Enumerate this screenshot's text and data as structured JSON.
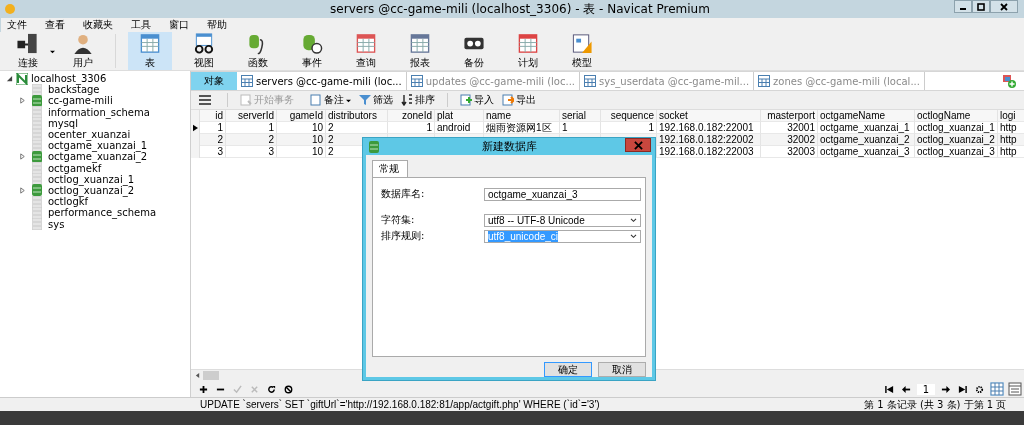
{
  "window": {
    "title": "servers @cc-game-mili (localhost_3306) - 表 - Navicat Premium"
  },
  "menu": [
    "文件",
    "查看",
    "收藏夹",
    "工具",
    "窗口",
    "帮助"
  ],
  "toolbar": [
    {
      "label": "连接",
      "selected": false
    },
    {
      "label": "用户",
      "selected": false
    },
    {
      "label": "表",
      "selected": true
    },
    {
      "label": "视图",
      "selected": false
    },
    {
      "label": "函数",
      "selected": false
    },
    {
      "label": "事件",
      "selected": false
    },
    {
      "label": "查询",
      "selected": false
    },
    {
      "label": "报表",
      "selected": false
    },
    {
      "label": "备份",
      "selected": false
    },
    {
      "label": "计划",
      "selected": false
    },
    {
      "label": "模型",
      "selected": false
    }
  ],
  "tree": {
    "label": "localhost_3306",
    "expanded": true,
    "children": [
      {
        "label": "backstage",
        "opened": false
      },
      {
        "label": "cc-game-mili",
        "opened": true
      },
      {
        "label": "information_schema",
        "opened": false
      },
      {
        "label": "mysql",
        "opened": false
      },
      {
        "label": "ocenter_xuanzai",
        "opened": false
      },
      {
        "label": "octgame_xuanzai_1",
        "opened": false
      },
      {
        "label": "octgame_xuanzai_2",
        "opened": true
      },
      {
        "label": "octgamekf",
        "opened": false
      },
      {
        "label": "octlog_xuanzai_1",
        "opened": false
      },
      {
        "label": "octlog_xuanzai_2",
        "opened": true
      },
      {
        "label": "octlogkf",
        "opened": false
      },
      {
        "label": "performance_schema",
        "opened": false
      },
      {
        "label": "sys",
        "opened": false
      }
    ]
  },
  "objects_tab": "对象",
  "tabs": [
    {
      "label": "servers @cc-game-mili (loc...",
      "selected": true
    },
    {
      "label": "updates @cc-game-mili (loc...",
      "selected": false
    },
    {
      "label": "sys_userdata @cc-game-mil...",
      "selected": false
    },
    {
      "label": "zones @cc-game-mili (local...",
      "selected": false
    }
  ],
  "table_toolbar": [
    {
      "label": "开始事务",
      "disabled": true
    },
    {
      "label": "备注",
      "disabled": false
    },
    {
      "label": "筛选",
      "disabled": false
    },
    {
      "label": "排序",
      "disabled": false
    },
    {
      "label": "导入",
      "disabled": false
    },
    {
      "label": "导出",
      "disabled": false
    }
  ],
  "table": {
    "columns": [
      {
        "label": "id",
        "numeric": true
      },
      {
        "label": "serverId",
        "numeric": true
      },
      {
        "label": "gameId",
        "numeric": true
      },
      {
        "label": "distributors",
        "numeric": false
      },
      {
        "label": "zoneId",
        "numeric": true
      },
      {
        "label": "plat",
        "numeric": false
      },
      {
        "label": "name",
        "numeric": false
      },
      {
        "label": "serial",
        "numeric": false
      },
      {
        "label": "sequence",
        "numeric": true
      },
      {
        "label": "socket",
        "numeric": false
      },
      {
        "label": "masterport",
        "numeric": true
      },
      {
        "label": "octgameName",
        "numeric": false
      },
      {
        "label": "octlogName",
        "numeric": false
      },
      {
        "label": "logi",
        "numeric": false
      }
    ],
    "rows": [
      {
        "selected": true,
        "cells": [
          "1",
          "1",
          "10",
          "2",
          "1",
          "android",
          "烟雨资源网1区",
          "1",
          "1",
          "192.168.0.182:22001",
          "32001",
          "octgame_xuanzai_1",
          "octlog_xuanzai_1",
          "http"
        ]
      },
      {
        "selected": false,
        "cells": [
          "2",
          "2",
          "10",
          "2",
          null,
          null,
          null,
          null,
          null,
          "192.168.0.182:22002",
          "32002",
          "octgame_xuanzai_2",
          "octlog_xuanzai_2",
          "http"
        ]
      },
      {
        "selected": false,
        "cells": [
          "3",
          "3",
          "10",
          "2",
          null,
          null,
          null,
          null,
          null,
          "192.168.0.182:22003",
          "32003",
          "octgame_xuanzai_3",
          "octlog_xuanzai_3",
          "http"
        ]
      }
    ]
  },
  "pager": {
    "page": "1"
  },
  "status_bar": {
    "sql": "UPDATE `servers` SET `giftUrl`='http://192.168.0.182:81/app/actgift.php' WHERE (`id`='3')",
    "records": "第 1 条记录 (共 3 条) 于第 1 页"
  },
  "dialog": {
    "title": "新建数据库",
    "tab": "常规",
    "fields": [
      {
        "label": "数据库名:",
        "value": "octgame_xuanzai_3",
        "kind": "text",
        "highlighted": false
      },
      {
        "label": "字符集:",
        "value": "utf8 -- UTF-8 Unicode",
        "kind": "select",
        "highlighted": false
      },
      {
        "label": "排序规则:",
        "value": "utf8_unicode_ci",
        "kind": "select",
        "highlighted": true
      }
    ],
    "buttons": [
      "确定",
      "取消"
    ]
  }
}
